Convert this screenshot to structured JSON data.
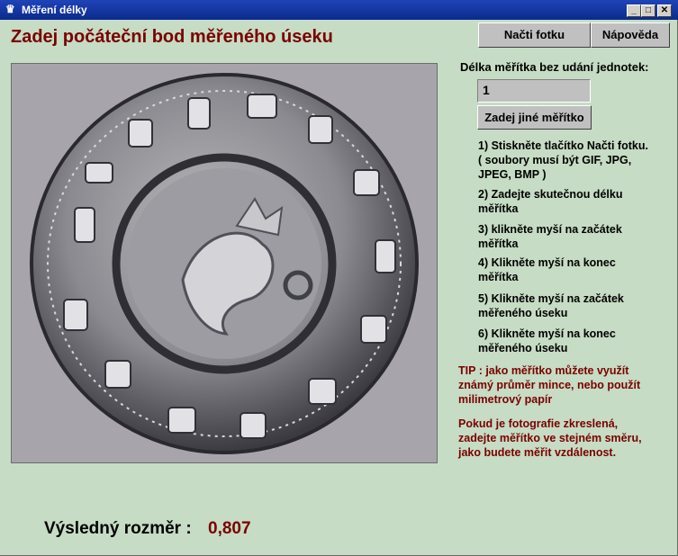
{
  "window": {
    "title": "Měření délky",
    "icon": "crown-icon",
    "min_label": "_",
    "max_label": "□",
    "close_label": "✕"
  },
  "heading": "Zadej počáteční bod měřeného úseku",
  "toolbar": {
    "load_label": "Načti fotku",
    "help_label": "Nápověda"
  },
  "scale": {
    "label": "Délka měřítka bez udání jednotek:",
    "value": "1",
    "button_label": "Zadej jiné měřítko"
  },
  "instructions": [
    {
      "lines": [
        "1) Stiskněte tlačítko Načti fotku.",
        "( soubory musí být GIF, JPG,",
        "JPEG, BMP )"
      ]
    },
    {
      "lines": [
        "2) Zadejte skutečnou délku",
        "měřítka"
      ]
    },
    {
      "lines": [
        "3) klikněte myší na začátek",
        "měřítka"
      ]
    },
    {
      "lines": [
        "4) Klikněte myší na konec",
        "měřítka"
      ]
    },
    {
      "lines": [
        "5) Klikněte myší na začátek",
        "měřeného úseku"
      ]
    },
    {
      "lines": [
        "6) Klikněte myší na konec",
        "měřeného úseku"
      ]
    }
  ],
  "tips": [
    {
      "lines": [
        "TIP : jako měřítko můžete využít",
        "známý průměr mince, nebo použít",
        "milimetrový papír"
      ]
    },
    {
      "lines": [
        "Pokud je fotografie zkreslená,",
        "zadejte měřítko ve stejném směru,",
        "jako budete měřit vzdálenost."
      ]
    }
  ],
  "result": {
    "label": "Výsledný rozměr :",
    "value": "0,807"
  },
  "colors": {
    "background": "#c6dcc4",
    "accent": "#7a0000",
    "titlebar": "#0a2a8c"
  }
}
